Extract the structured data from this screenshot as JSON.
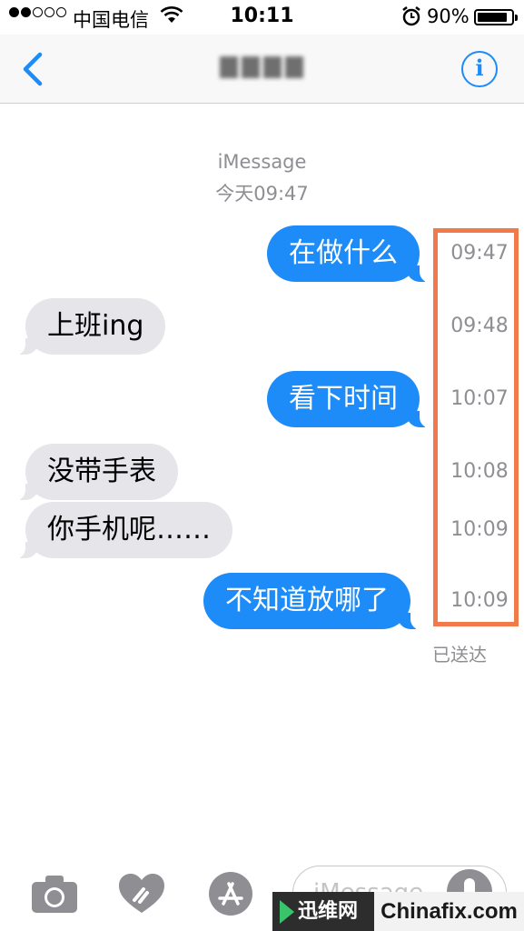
{
  "status_bar": {
    "carrier": "中国电信",
    "time": "10:11",
    "battery_percent": "90%",
    "battery_level": 0.9,
    "signal_bars_filled": 2,
    "signal_bars_total": 5
  },
  "nav": {
    "back_icon": "chevron-left-icon",
    "contact_name": "",
    "info_label": "i"
  },
  "thread": {
    "service": "iMessage",
    "date": "今天09:47"
  },
  "messages": [
    {
      "direction": "sent",
      "text": "在做什么",
      "time": "09:47"
    },
    {
      "direction": "received",
      "text": "上班ing",
      "time": "09:48"
    },
    {
      "direction": "sent",
      "text": "看下时间",
      "time": "10:07"
    },
    {
      "direction": "received",
      "text": "没带手表",
      "time": "10:08"
    },
    {
      "direction": "received",
      "text": "你手机呢……",
      "time": "10:09"
    },
    {
      "direction": "sent",
      "text": "不知道放哪了",
      "time": "10:09"
    }
  ],
  "delivery_status": "已送达",
  "composer": {
    "placeholder": "iMessage"
  },
  "watermark": {
    "left_text": "迅维网",
    "right_text": "Chinafix.com"
  },
  "colors": {
    "sent_bubble": "#1d8cf8",
    "received_bubble": "#e5e5ea",
    "highlight": "#f07a4a",
    "accent": "#1d8cf8"
  }
}
